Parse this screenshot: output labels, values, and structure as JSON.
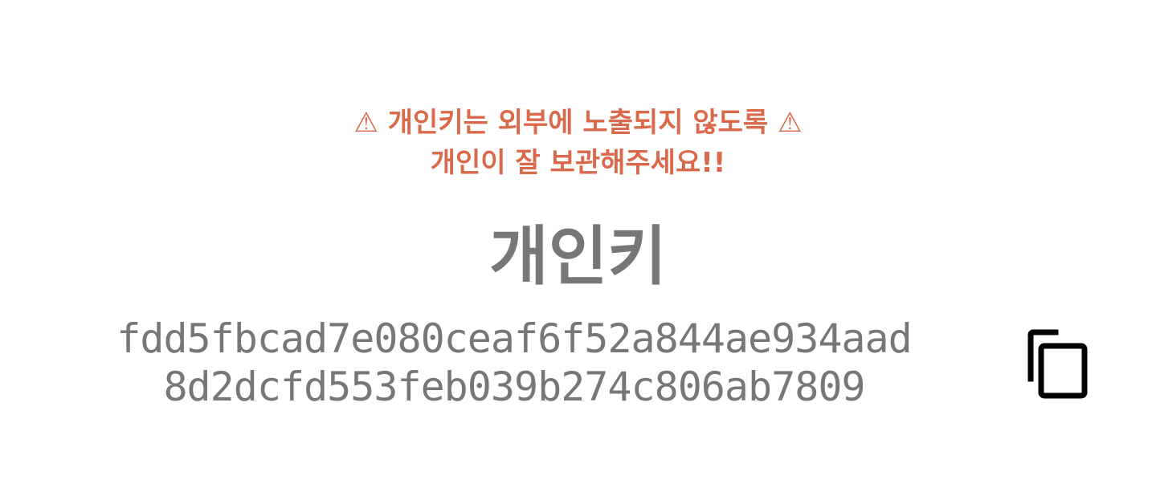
{
  "warning": {
    "line1": "⚠ 개인키는 외부에 노출되지 않도록 ⚠",
    "line2": "개인이 잘 보관해주세요!!",
    "color": "#d9694a"
  },
  "title": "개인키",
  "private_key": {
    "line1": "fdd5fbcad7e080ceaf6f52a844ae934aad",
    "line2": "8d2dcfd553feb039b274c806ab7809"
  },
  "copy_icon": "copy-icon"
}
